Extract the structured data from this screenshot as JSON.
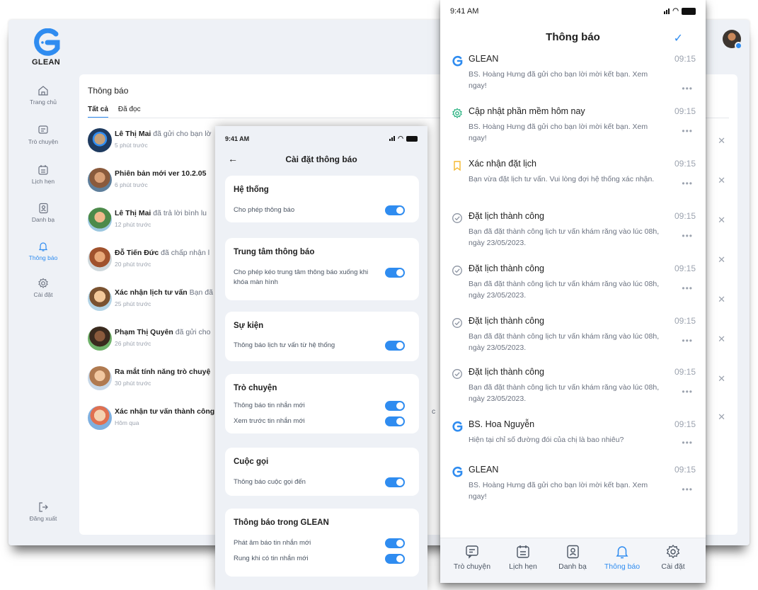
{
  "brand": {
    "name": "GLEAN",
    "accent": "#2f8cf0"
  },
  "desktop": {
    "sidebar": [
      {
        "label": "Trang chủ",
        "icon": "home-icon",
        "active": false
      },
      {
        "label": "Trò chuyện",
        "icon": "chat-icon",
        "active": false
      },
      {
        "label": "Lịch hẹn",
        "icon": "calendar-icon",
        "active": false
      },
      {
        "label": "Danh bạ",
        "icon": "contacts-icon",
        "active": false
      },
      {
        "label": "Thông báo",
        "icon": "bell-icon",
        "active": true
      },
      {
        "label": "Cài đặt",
        "icon": "gear-icon",
        "active": false
      }
    ],
    "logout": "Đăng xuất",
    "title": "Thông báo",
    "tabs": [
      {
        "label": "Tất cả",
        "active": true
      },
      {
        "label": "Đã đọc",
        "active": false
      }
    ],
    "items": [
      {
        "name": "Lê Thị Mai",
        "rest": " đã gửi cho bạn lờ",
        "time": "5 phút trước"
      },
      {
        "name": "Phiên bản mới ver 10.2.05",
        "rest": "",
        "time": "6 phút trước"
      },
      {
        "name": "Lê Thị Mai",
        "rest": " đã trả lời bình lu",
        "time": "12 phút trước"
      },
      {
        "name": "Đỗ Tiến Đức",
        "rest": " đã chấp nhận l",
        "time": "20 phút trước"
      },
      {
        "name": "Xác nhận lịch tư vấn",
        "rest": " Bạn đã",
        "time": "25 phút trước"
      },
      {
        "name": "Phạm Thị Quyên",
        "rest": " đã gửi cho",
        "time": "26 phút trước"
      },
      {
        "name": "Ra mắt tính năng trò chuyệ",
        "rest": "",
        "time": "30 phút trước"
      },
      {
        "name": "Xác nhận tư vấn thành công",
        "rest": "",
        "time": "Hôm qua"
      }
    ],
    "stray_text": "c"
  },
  "settings": {
    "status_time": "9:41 AM",
    "title": "Cài đặt thông báo",
    "sections": [
      {
        "heading": "Hệ thống",
        "rows": [
          "Cho phép thông báo"
        ]
      },
      {
        "heading": "Trung tâm thông báo",
        "rows": [
          "Cho phép kéo trung tâm thông báo xuống khi khóa màn hình"
        ]
      },
      {
        "heading": "Sự kiện",
        "rows": [
          "Thông báo lịch tư vấn từ hệ thống"
        ]
      },
      {
        "heading": "Trò chuyện",
        "rows": [
          "Thông báo tin nhắn mới",
          "Xem trước tin nhắn mới"
        ]
      },
      {
        "heading": "Cuộc gọi",
        "rows": [
          "Thông báo cuộc gọi đến"
        ]
      },
      {
        "heading": "Thông báo trong GLEAN",
        "rows": [
          "Phát âm báo tin nhắn mới",
          "Rung khi có tin nhắn mới"
        ]
      }
    ]
  },
  "notifications": {
    "status_time": "9:41 AM",
    "title": "Thông báo",
    "items": [
      {
        "icon": "glean-logo-icon",
        "title": "GLEAN",
        "time": "09:15",
        "body": "BS. Hoàng Hưng đã gửi cho bạn lời mời kết bạn. Xem ngay!"
      },
      {
        "icon": "update-gear-icon",
        "title": "Cập nhật phần mềm hôm nay",
        "time": "09:15",
        "body": "BS. Hoàng Hưng đã gửi cho bạn lời mời kết bạn. Xem ngay!"
      },
      {
        "icon": "bookmark-icon",
        "title": "Xác nhận đặt lịch",
        "time": "09:15",
        "body": "Bạn vừa đặt lịch tư vấn. Vui lòng đợi hệ thống xác nhận."
      },
      {
        "icon": "check-circle-icon",
        "title": "Đặt lịch thành công",
        "time": "09:15",
        "body": "Bạn đã đặt thành công lịch tư vấn khám răng vào lúc 08h, ngày 23/05/2023."
      },
      {
        "icon": "check-circle-icon",
        "title": "Đặt lịch thành công",
        "time": "09:15",
        "body": "Bạn đã đặt thành công lịch tư vấn khám răng vào lúc 08h, ngày 23/05/2023."
      },
      {
        "icon": "check-circle-icon",
        "title": "Đặt lịch thành công",
        "time": "09:15",
        "body": "Bạn đã đặt thành công lịch tư vấn khám răng vào lúc 08h, ngày 23/05/2023."
      },
      {
        "icon": "check-circle-icon",
        "title": "Đặt lịch thành công",
        "time": "09:15",
        "body": "Bạn đã đặt thành công lịch tư vấn khám răng vào lúc 08h, ngày 23/05/2023."
      },
      {
        "icon": "glean-logo-icon",
        "title": "BS. Hoa Nguyễn",
        "time": "09:15",
        "body": "Hiện tại chỉ số đường đói của chị là bao nhiêu?"
      },
      {
        "icon": "glean-logo-icon",
        "title": "GLEAN",
        "time": "09:15",
        "body": "BS. Hoàng Hưng đã gửi cho bạn lời mời kết bạn. Xem ngay!"
      }
    ],
    "more": "•••",
    "tabbar": [
      {
        "label": "Trò chuyện",
        "icon": "chat-icon",
        "active": false
      },
      {
        "label": "Lịch hẹn",
        "icon": "calendar-icon",
        "active": false
      },
      {
        "label": "Danh bạ",
        "icon": "contacts-icon",
        "active": false
      },
      {
        "label": "Thông báo",
        "icon": "bell-icon",
        "active": true
      },
      {
        "label": "Cài đặt",
        "icon": "gear-icon",
        "active": false
      }
    ]
  }
}
